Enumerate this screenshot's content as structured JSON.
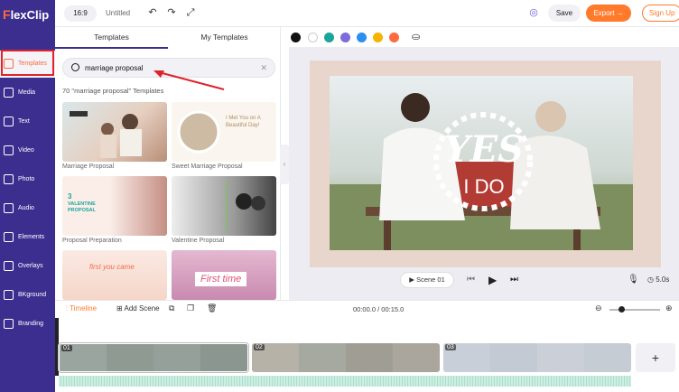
{
  "app": {
    "logo_text": "lexClip",
    "logo_mark": "F"
  },
  "sidebar": {
    "items": [
      {
        "label": "Templates",
        "icon": "templates-icon"
      },
      {
        "label": "Media",
        "icon": "media-icon"
      },
      {
        "label": "Text",
        "icon": "text-icon"
      },
      {
        "label": "Video",
        "icon": "video-icon"
      },
      {
        "label": "Photo",
        "icon": "photo-icon"
      },
      {
        "label": "Audio",
        "icon": "audio-icon"
      },
      {
        "label": "Elements",
        "icon": "elements-icon"
      },
      {
        "label": "Overlays",
        "icon": "overlays-icon"
      },
      {
        "label": "BKground",
        "icon": "background-icon"
      },
      {
        "label": "Branding",
        "icon": "branding-icon"
      }
    ]
  },
  "topbar": {
    "ratio": "16:9",
    "title": "Untitled",
    "save": "Save",
    "export": "Export →",
    "signup": "Sign Up"
  },
  "panel": {
    "tabs": [
      "Templates",
      "My Templates"
    ],
    "search_value": "marriage proposal",
    "result_count": "70 \"marriage proposal\" Templates",
    "templates": [
      {
        "caption": "Marriage Proposal"
      },
      {
        "caption": "Sweet Marriage Proposal",
        "overlay": "I Met You on A Beautiful Day!"
      },
      {
        "caption": "Proposal Preparation",
        "overlay_top": "3",
        "overlay": "VALENTINE PROPOSAL"
      },
      {
        "caption": "Valentine Proposal"
      },
      {
        "caption": "",
        "overlay": "first you came"
      },
      {
        "caption": "",
        "overlay": "First time"
      }
    ]
  },
  "palette": {
    "colors": [
      "#111111",
      "#ffffff",
      "#1aa59a",
      "#7b6cd9",
      "#2b8ff0",
      "#f5b400",
      "#ff6a3d"
    ]
  },
  "canvas": {
    "overlay_top": "YES",
    "overlay_bottom": "I DO"
  },
  "player": {
    "scene": "Scene 01",
    "speed": "5.0s"
  },
  "timeline": {
    "label": "Timeline",
    "add_scene": "Add Scene",
    "time": "00:00.0 / 00:15.0",
    "clips": [
      "01",
      "02",
      "03"
    ]
  },
  "colors": {
    "accent": "#ff7a2b",
    "sidebar": "#3b2e8f",
    "highlight": "#e0232b"
  }
}
